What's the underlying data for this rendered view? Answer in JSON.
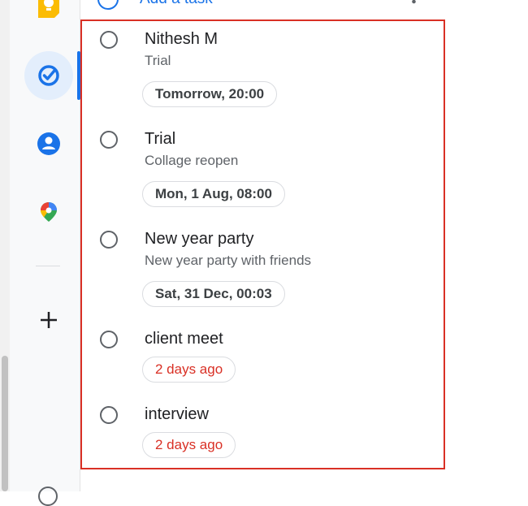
{
  "header": {
    "add_task_label": "Add a task"
  },
  "rail": {
    "icons": [
      "keep-icon",
      "tasks-icon",
      "contacts-icon",
      "maps-icon",
      "add-icon"
    ]
  },
  "colors": {
    "accent": "#1a73e8",
    "overdue": "#d93025",
    "highlight": "#d93025"
  },
  "tasks": [
    {
      "title": "Nithesh M",
      "description": "Trial",
      "due": "Tomorrow, 20:00",
      "overdue": false
    },
    {
      "title": "Trial",
      "description": "Collage reopen",
      "due": "Mon, 1 Aug, 08:00",
      "overdue": false
    },
    {
      "title": "New year party",
      "description": "New year party with friends",
      "due": "Sat, 31 Dec, 00:03",
      "overdue": false
    },
    {
      "title": "client meet",
      "description": "",
      "due": "2 days ago",
      "overdue": true
    },
    {
      "title": "interview",
      "description": "",
      "due": "2 days ago",
      "overdue": true
    }
  ]
}
